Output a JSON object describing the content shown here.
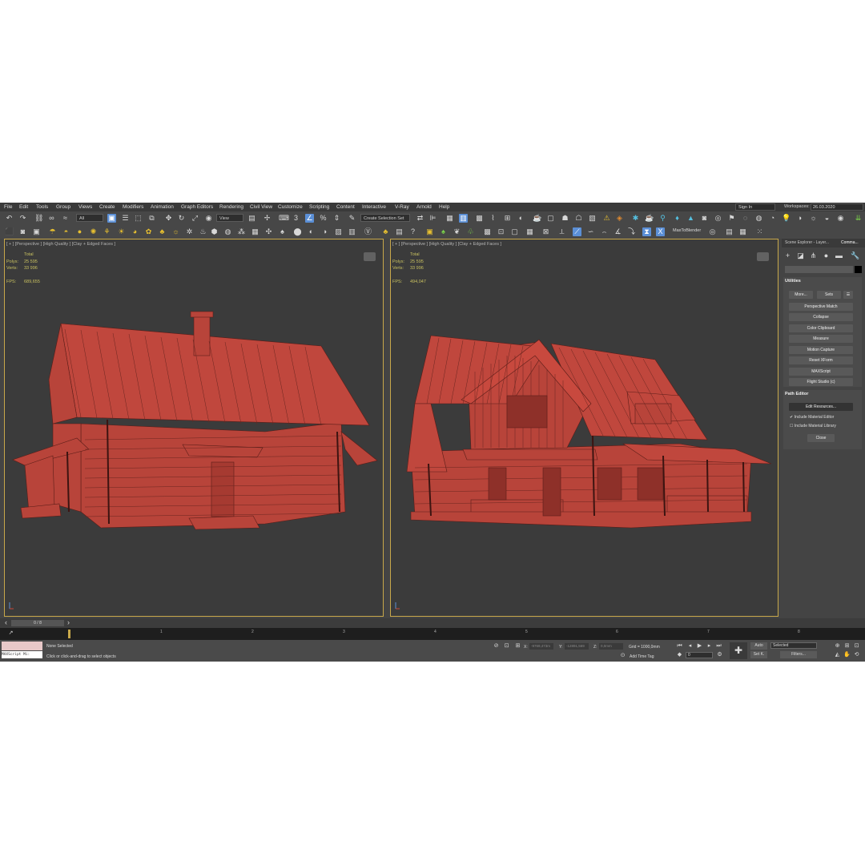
{
  "menu": [
    "File",
    "Edit",
    "Tools",
    "Group",
    "Views",
    "Create",
    "Modifiers",
    "Animation",
    "Graph Editors",
    "Rendering",
    "Civil View",
    "Customize",
    "Scripting",
    "Content",
    "Interactive",
    "V-Ray",
    "Arnold",
    "Help"
  ],
  "signin": "Sign In",
  "workspaces_label": "Workspaces:",
  "workspaces_value": "26.03.2020",
  "toolbar": {
    "filter": "All",
    "ref_coord": "View",
    "selection_set": "Create Selection Set",
    "max_to_blender": "MaxToBlender"
  },
  "viewport_left": {
    "label": "[ + ] [Perspective ] [High Quality ] [Clay + Edged Faces ]",
    "total": "Total",
    "polys_label": "Polys:",
    "polys": "25 595",
    "verts_label": "Verts:",
    "verts": "33 996",
    "fps_label": "FPS:",
    "fps": "689,655"
  },
  "viewport_right": {
    "label": "[ + ] [Perspective ] [High Quality ] [Clay + Edged Faces ]",
    "total": "Total",
    "polys_label": "Polys:",
    "polys": "25 595",
    "verts_label": "Verts:",
    "verts": "33 996",
    "fps_label": "FPS:",
    "fps": "494,047"
  },
  "panel": {
    "tab1": "Scene Explorer - Layer...",
    "tab2": "Comma...",
    "utilities_title": "Utilities",
    "more": "More...",
    "sets": "Sets",
    "buttons": [
      "Perspective Match",
      "Collapse",
      "Color Clipboard",
      "Measure",
      "Motion Capture",
      "Reset XForm",
      "MAXScript",
      "Flight Studio (c)"
    ],
    "path_editor_title": "Path Editor",
    "edit_resources": "Edit Resources...",
    "include_editor": "Include Material Editor",
    "include_library": "Include Material Library",
    "close": "Close"
  },
  "timeline": {
    "slider": "0 / 8",
    "ticks": [
      "1",
      "2",
      "3",
      "4",
      "5",
      "6",
      "7",
      "8"
    ]
  },
  "status": {
    "maxscript": "MAXScript Mi:",
    "none_selected": "None Selected",
    "prompt": "Click or click-and-drag to select objects",
    "x_label": "X:",
    "x_val": "-9769,473m",
    "y_label": "Y:",
    "y_val": "-12891,569",
    "z_label": "Z:",
    "z_val": "0,0mm",
    "grid": "Grid = 1000,0mm",
    "add_time_tag": "Add Time Tag",
    "auto": "Auto",
    "set_k": "Set K.",
    "selected": "Selected",
    "filters": "Filters...",
    "frame": "0"
  },
  "colors": {
    "house": "#b8443a",
    "house_dark": "#7a2a24",
    "viewport_bg": "#3b3b3b",
    "active_border": "#c8a84a",
    "ui_bg": "#444444"
  }
}
